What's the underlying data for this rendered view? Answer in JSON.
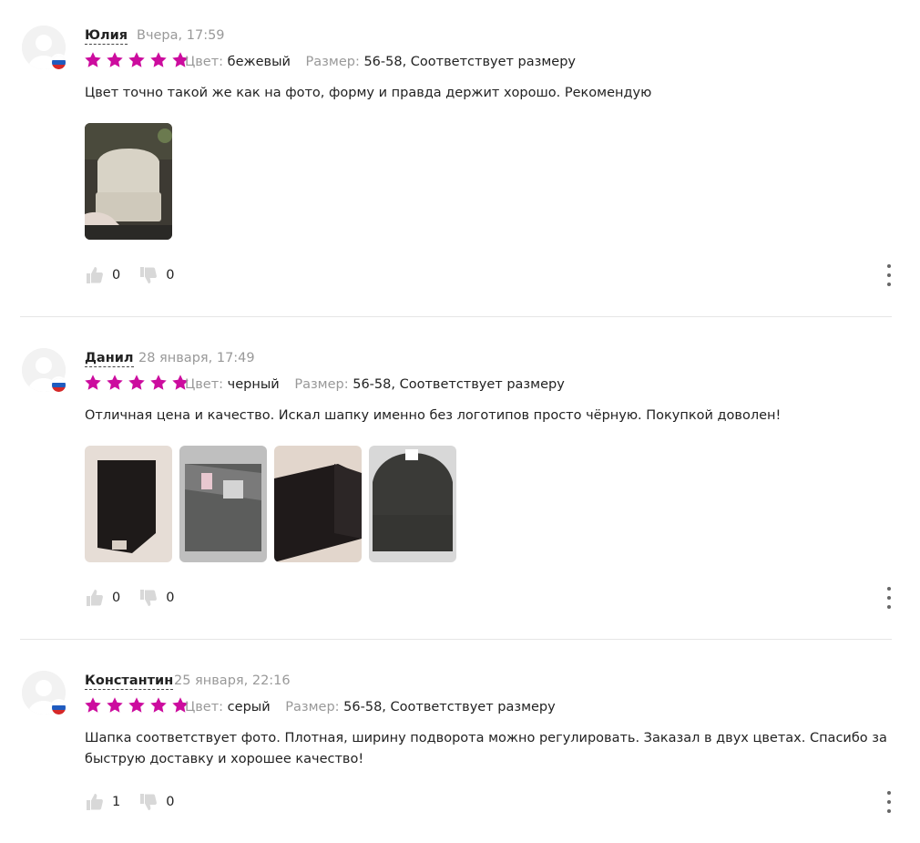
{
  "reviews": [
    {
      "name": "Юлия",
      "date": "Вчера, 17:59",
      "rating": 5,
      "color_label": "Цвет:",
      "color_value": "бежевый",
      "size_label": "Размер:",
      "size_value": "56-58, Соответствует размеру",
      "text": "Цвет точно такой же как на фото, форму и правда держит хорошо. Рекомендую",
      "likes": "0",
      "dislikes": "0"
    },
    {
      "name": "Данил",
      "date": "28 января, 17:49",
      "rating": 5,
      "color_label": "Цвет:",
      "color_value": "черный",
      "size_label": "Размер:",
      "size_value": "56-58, Соответствует размеру",
      "text": "Отличная цена и качество. Искал шапку именно без логотипов просто чёрную. Покупкой доволен!",
      "likes": "0",
      "dislikes": "0"
    },
    {
      "name": "Константин",
      "date": "25 января, 22:16",
      "rating": 5,
      "color_label": "Цвет:",
      "color_value": "серый",
      "size_label": "Размер:",
      "size_value": "56-58, Соответствует размеру",
      "text": "Шапка соответствует фото. Плотная, ширину подворота можно регулировать. Заказал в двух цветах. Спасибо за быструю доставку и хорошее качество!",
      "likes": "1",
      "dislikes": "0"
    }
  ],
  "colors": {
    "star": "#cc0c9e",
    "muted": "#999999",
    "text": "#222222",
    "divider": "#e6e6e6"
  },
  "icons": {
    "like": "thumbs-up-icon",
    "dislike": "thumbs-down-icon",
    "more": "more-vertical-icon",
    "flag": "russia-flag-icon"
  }
}
